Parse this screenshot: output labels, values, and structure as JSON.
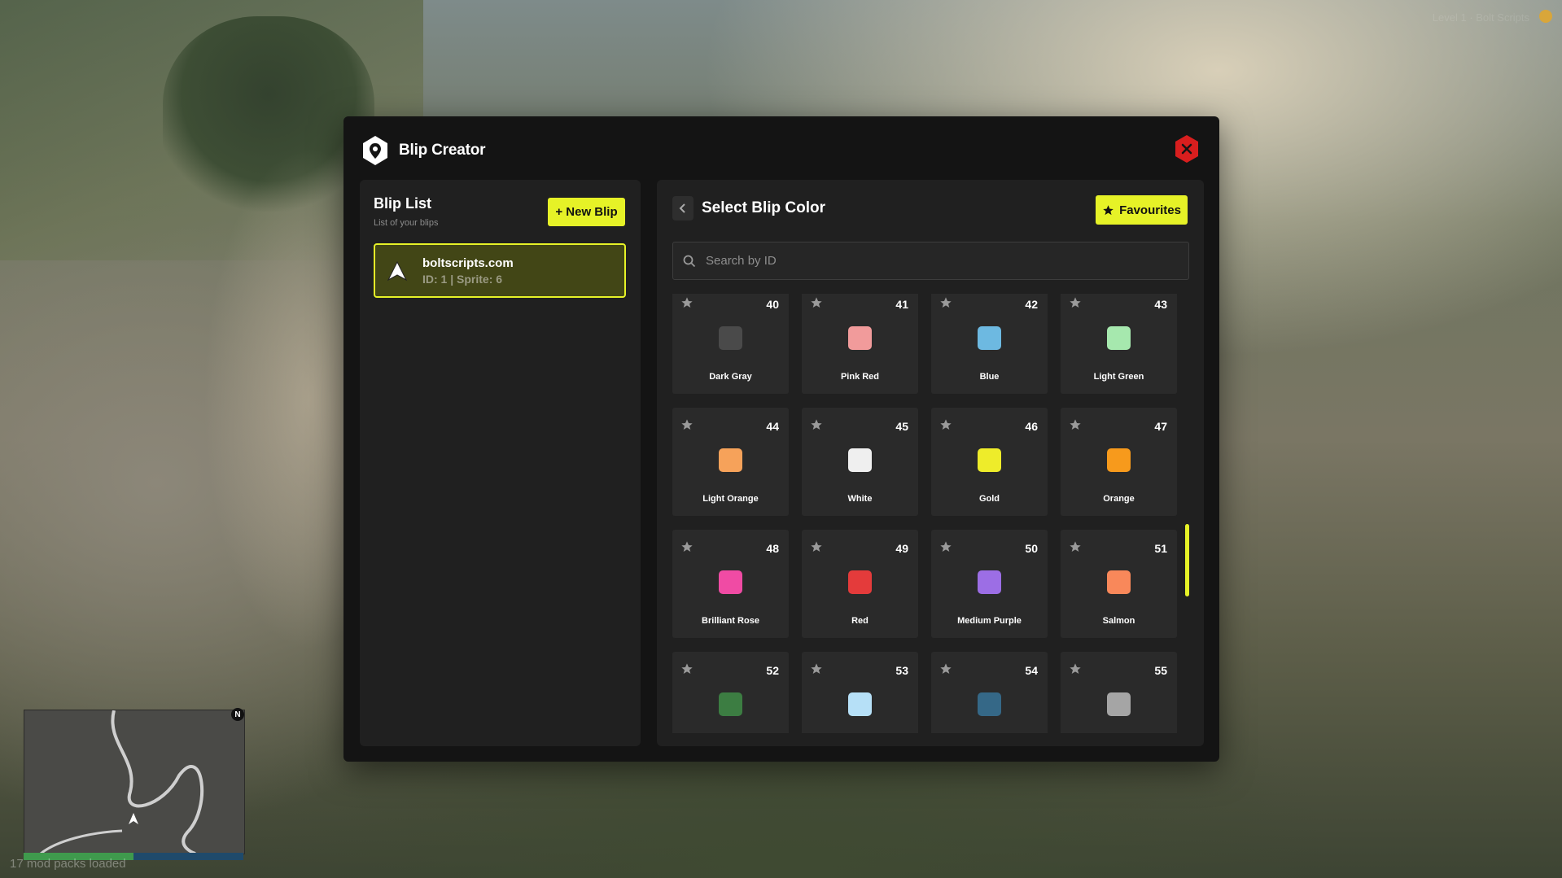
{
  "app": {
    "title": "Blip Creator"
  },
  "blip_list": {
    "title": "Blip List",
    "subtitle": "List of your blips",
    "new_button": "+ New Blip",
    "items": [
      {
        "name": "boltscripts.com",
        "meta": "ID: 1 | Sprite: 6"
      }
    ]
  },
  "color_picker": {
    "title": "Select Blip Color",
    "favourites_label": "Favourites",
    "search_placeholder": "Search by ID",
    "colors": [
      {
        "id": "40",
        "name": "Dark Gray",
        "hex": "#4a4a4a"
      },
      {
        "id": "41",
        "name": "Pink Red",
        "hex": "#f19b9b"
      },
      {
        "id": "42",
        "name": "Blue",
        "hex": "#6db9e1"
      },
      {
        "id": "43",
        "name": "Light Green",
        "hex": "#a6e8ae"
      },
      {
        "id": "44",
        "name": "Light Orange",
        "hex": "#f6a25a"
      },
      {
        "id": "45",
        "name": "White",
        "hex": "#efefef"
      },
      {
        "id": "46",
        "name": "Gold",
        "hex": "#eeec2a"
      },
      {
        "id": "47",
        "name": "Orange",
        "hex": "#f79a1c"
      },
      {
        "id": "48",
        "name": "Brilliant Rose",
        "hex": "#f04ba4"
      },
      {
        "id": "49",
        "name": "Red",
        "hex": "#e43b3b"
      },
      {
        "id": "50",
        "name": "Medium Purple",
        "hex": "#9c6ee5"
      },
      {
        "id": "51",
        "name": "Salmon",
        "hex": "#f9885a"
      },
      {
        "id": "52",
        "name": "",
        "hex": "#3c7d42"
      },
      {
        "id": "53",
        "name": "",
        "hex": "#b6e0f7"
      },
      {
        "id": "54",
        "name": "",
        "hex": "#356887"
      },
      {
        "id": "55",
        "name": "",
        "hex": "#a5a5a5"
      }
    ]
  },
  "hud": {
    "status": "17 mod packs loaded",
    "compass": "N",
    "watermark": "Level 1 · Bolt Scripts"
  },
  "theme": {
    "accent": "#e6f227",
    "close": "#d81e1e"
  }
}
